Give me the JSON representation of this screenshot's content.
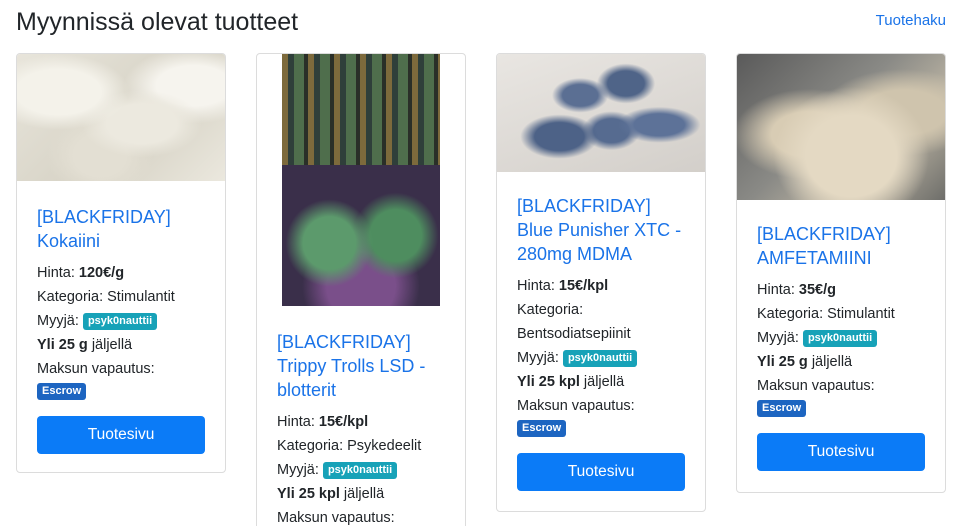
{
  "header": {
    "title": "Myynnissä olevat tuotteet",
    "search_link": "Tuotehaku"
  },
  "products": [
    {
      "image_icon": "white-powder-photo",
      "title": "[BLACKFRIDAY] Kokaiini",
      "price_label": "Hinta:",
      "price": "120€/g",
      "category_label": "Kategoria:",
      "category": "Stimulantit",
      "seller_label": "Myyjä:",
      "seller": "psyk0nauttii",
      "stock_prefix": "Yli 25 g",
      "stock_suffix": "jäljellä",
      "payment_label": "Maksun vapautus:",
      "payment": "Escrow",
      "button": "Tuotesivu"
    },
    {
      "image_icon": "blotter-art-photo",
      "title": "[BLACKFRIDAY] Trippy Trolls LSD -blotterit",
      "price_label": "Hinta:",
      "price": "15€/kpl",
      "category_label": "Kategoria:",
      "category": "Psykedeelit",
      "seller_label": "Myyjä:",
      "seller": "psyk0nauttii",
      "stock_prefix": "Yli 25 kpl",
      "stock_suffix": "jäljellä",
      "payment_label": "Maksun vapautus:"
    },
    {
      "image_icon": "blue-pills-photo",
      "title": "[BLACKFRIDAY] Blue Punisher XTC - 280mg MDMA",
      "price_label": "Hinta:",
      "price": "15€/kpl",
      "category_label": "Kategoria:",
      "category": "Bentsodiatsepiinit",
      "seller_label": "Myyjä:",
      "seller": "psyk0nauttii",
      "stock_prefix": "Yli 25 kpl",
      "stock_suffix": "jäljellä",
      "payment_label": "Maksun vapautus:",
      "payment": "Escrow",
      "button": "Tuotesivu"
    },
    {
      "image_icon": "crystal-powder-photo",
      "title": "[BLACKFRIDAY] AMFETAMIINI",
      "price_label": "Hinta:",
      "price": "35€/g",
      "category_label": "Kategoria:",
      "category": "Stimulantit",
      "seller_label": "Myyjä:",
      "seller": "psyk0nauttii",
      "stock_prefix": "Yli 25 g",
      "stock_suffix": "jäljellä",
      "payment_label": "Maksun vapautus:",
      "payment": "Escrow",
      "button": "Tuotesivu"
    }
  ]
}
